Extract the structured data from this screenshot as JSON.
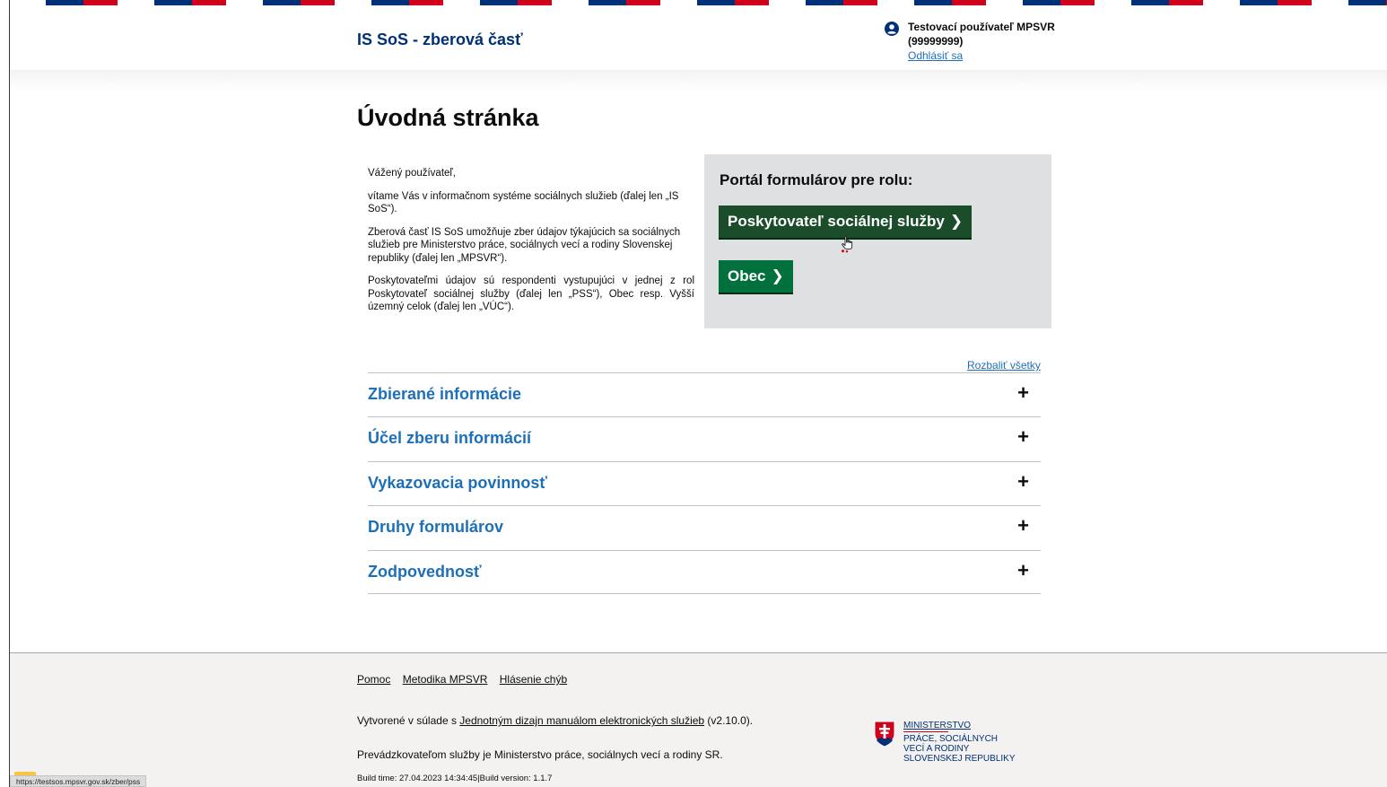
{
  "header": {
    "brand": "IS SoS - zberová časť",
    "user_name": "Testovací používateľ MPSVR",
    "user_id": "(99999999)",
    "logout": "Odhlásiť sa",
    "stripe_colors": [
      "#003078",
      "#d0021b"
    ]
  },
  "page": {
    "title": "Úvodná stránka"
  },
  "intro": {
    "greeting": "Vážený používateľ,",
    "p1": "vítame Vás v informačnom systéme sociálnych služieb (ďalej len „IS SoS“).",
    "p2": "Zberová časť IS SoS umožňuje zber údajov týkajúcich sa sociálnych služieb pre Ministerstvo práce, sociálnych vecí a rodiny Slovenskej republiky (ďalej len „MPSVR“).",
    "p3": "Poskytovateľmi údajov sú respondenti vystupujúci v jednej z rol Poskytovateľ sociálnej služby (ďalej len „PSS“), Obec resp. Vyšší územný celok (ďalej len „VÚC“)."
  },
  "portal": {
    "title": "Portál formulárov pre rolu:",
    "buttons": [
      {
        "label": "Poskytovateľ sociálnej služby"
      },
      {
        "label": "Obec"
      }
    ],
    "chevron": "❯"
  },
  "accordion": {
    "expand_all": "Rozbaliť všetky",
    "plus": "+",
    "items": [
      {
        "title": "Zbierané informácie"
      },
      {
        "title": "Účel zberu informácií"
      },
      {
        "title": "Vykazovacia povinnosť"
      },
      {
        "title": "Druhy formulárov"
      },
      {
        "title": "Zodpovednosť"
      }
    ]
  },
  "footer": {
    "links": [
      "Pomoc",
      "Metodika MPSVR",
      "Hlásenie chýb"
    ],
    "line1_prefix": "Vytvorené v súlade s ",
    "line1_link": "Jednotným dizajn manuálom elektronických služieb",
    "line1_suffix": " (v2.10.0).",
    "line2": "Prevádzkovateľom služby je Ministerstvo práce, sociálnych vecí a rodiny SR.",
    "build": "Build time: 27.04.2023 14:34:45|Build version: 1.1.7",
    "ministry": {
      "line1": "Ministerstvo",
      "line2": "práce, sociálnych",
      "line3": "vecí a rodiny",
      "line4": "Slovenskej republiky"
    }
  },
  "status_bar": {
    "url": "https://testsos.mpsvr.gov.sk/zber/pss"
  }
}
